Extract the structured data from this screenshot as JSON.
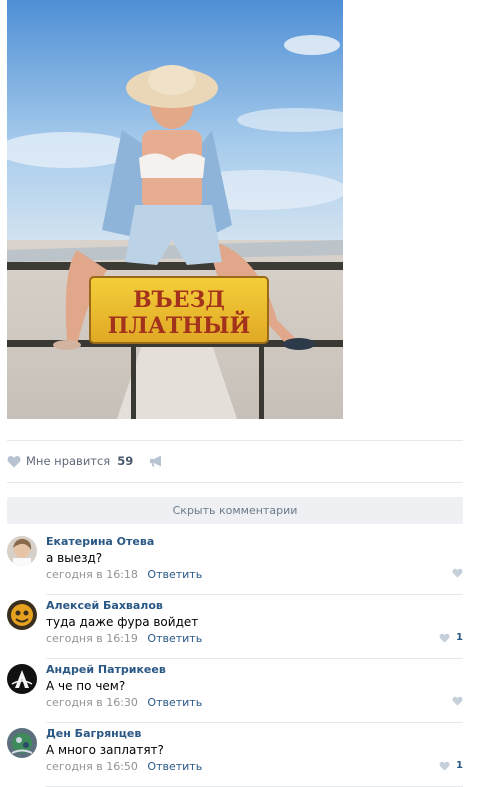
{
  "post": {
    "photo": {
      "sign_line1": "ВЪЕЗД",
      "sign_line2": "ПЛАТНЫЙ"
    },
    "like_label": "Мне нравится",
    "like_count": "59",
    "hide_comments_label": "Скрыть комментарии"
  },
  "colors": {
    "link": "#2a5885",
    "muted": "#939393",
    "divider": "#e7e8ec",
    "button_bg": "#eef0f3"
  },
  "comments": [
    {
      "author": "Екатерина Отева",
      "text": "а выезд?",
      "time": "сегодня в 16:18",
      "reply": "Ответить",
      "likes": ""
    },
    {
      "author": "Алексей Бахвалов",
      "text": "туда даже фура войдет",
      "time": "сегодня в 16:19",
      "reply": "Ответить",
      "likes": "1"
    },
    {
      "author": "Андрей Патрикеев",
      "text": "А че по чем?",
      "time": "сегодня в 16:30",
      "reply": "Ответить",
      "likes": ""
    },
    {
      "author": "Ден Багрянцев",
      "text": "А много заплатят?",
      "time": "сегодня в 16:50",
      "reply": "Ответить",
      "likes": "1"
    }
  ],
  "icons": {
    "like": "heart-icon",
    "share": "megaphone-icon"
  }
}
